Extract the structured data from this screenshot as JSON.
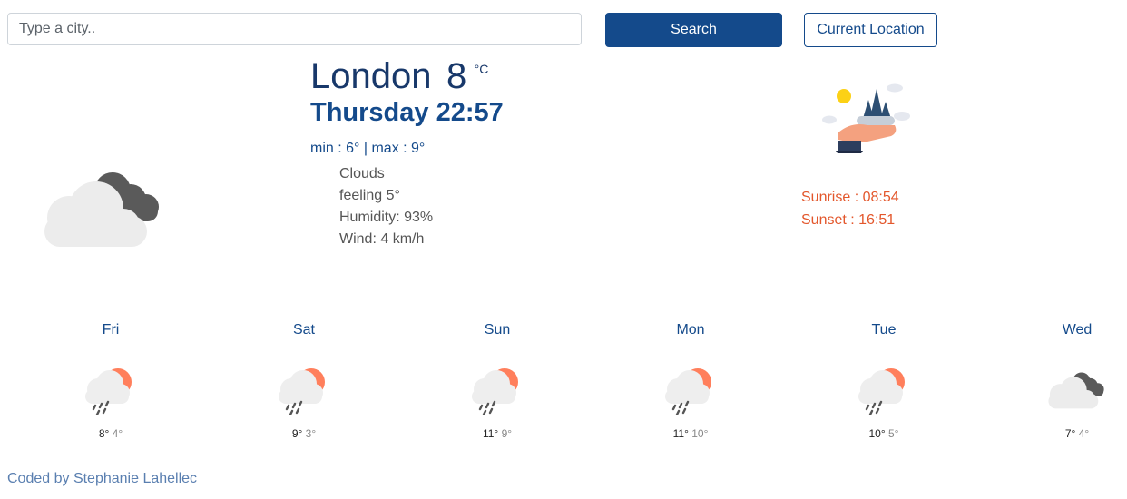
{
  "search": {
    "placeholder": "Type a city..",
    "button_label": "Search",
    "location_button_label": "Current Location"
  },
  "current": {
    "city": "London",
    "temperature": "8",
    "unit": "°C",
    "datetime": "Thursday 22:57",
    "min_max": "min : 6° | max : 9°",
    "description": "Clouds",
    "feeling": "feeling 5°",
    "humidity": "Humidity: 93%",
    "wind": "Wind: 4 km/h",
    "icon": "broken-clouds-icon"
  },
  "sun": {
    "sunrise": "Sunrise : 08:54",
    "sunset": "Sunset : 16:51"
  },
  "forecast": [
    {
      "day": "Fri",
      "max": "8°",
      "min": "4°",
      "icon": "rain-sun-icon"
    },
    {
      "day": "Sat",
      "max": "9°",
      "min": "3°",
      "icon": "rain-sun-icon"
    },
    {
      "day": "Sun",
      "max": "11°",
      "min": "9°",
      "icon": "rain-sun-icon"
    },
    {
      "day": "Mon",
      "max": "11°",
      "min": "10°",
      "icon": "rain-sun-icon"
    },
    {
      "day": "Tue",
      "max": "10°",
      "min": "5°",
      "icon": "rain-sun-icon"
    },
    {
      "day": "Wed",
      "max": "7°",
      "min": "4°",
      "icon": "broken-clouds-icon"
    }
  ],
  "footer": {
    "credit": "Coded by Stephanie Lahellec"
  },
  "colors": {
    "primary": "#144a8b",
    "title": "#18386a",
    "sun_text": "#e3572c",
    "link": "#5a7fb0"
  }
}
